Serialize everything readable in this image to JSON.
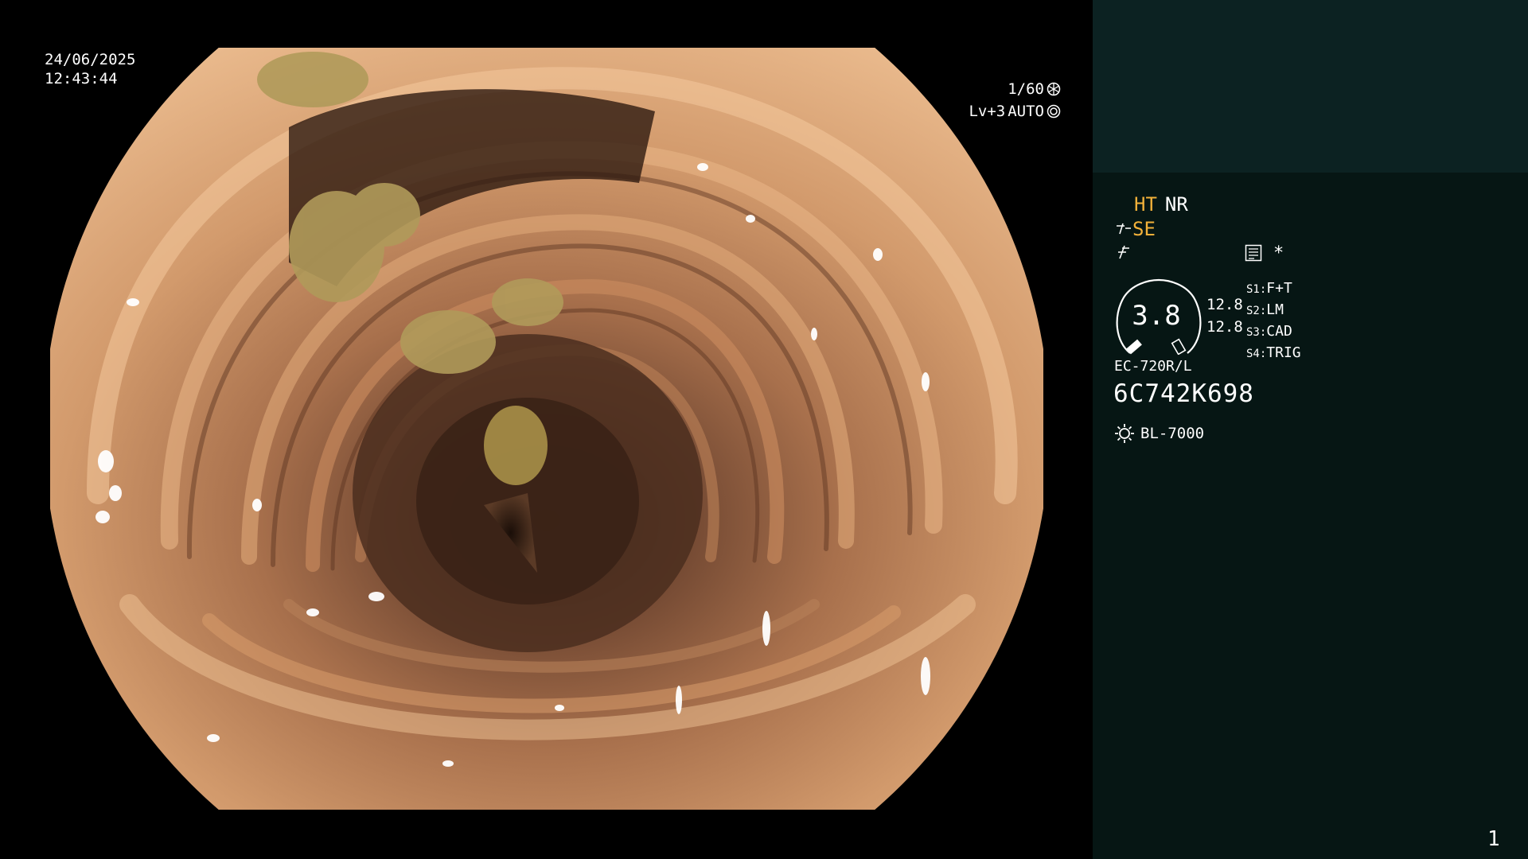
{
  "overlay": {
    "date": "24/06/2025",
    "time": "12:43:44",
    "shutter_speed": "1/60",
    "exposure_level": "Lv+3",
    "exposure_mode": "AUTO"
  },
  "panel": {
    "modes": [
      "HT",
      "NR"
    ],
    "structure_enhancement": "SE",
    "asterisk": "*",
    "zoom_readout": "3.8",
    "zoom_a": "12.8",
    "zoom_b": "12.8",
    "softkeys": [
      {
        "key": "S1:",
        "value": "F+T"
      },
      {
        "key": "S2:",
        "value": "LM"
      },
      {
        "key": "S3:",
        "value": "CAD"
      },
      {
        "key": "S4:",
        "value": "TRIG"
      }
    ],
    "scope_model": "EC-720R/L",
    "scope_serial": "6C742K698",
    "light_source": "BL-7000",
    "page_number": "1"
  },
  "colors": {
    "panel_top": "#0c2222",
    "panel_bottom": "#061614",
    "accent_amber": "#f2b13a",
    "tissue_base": "#c98b5e"
  },
  "icons": [
    "iris-icon",
    "auto-iris-icon",
    "structure-enhancement-icon",
    "color-mode-icon",
    "menu-list-icon",
    "light-source-icon"
  ]
}
